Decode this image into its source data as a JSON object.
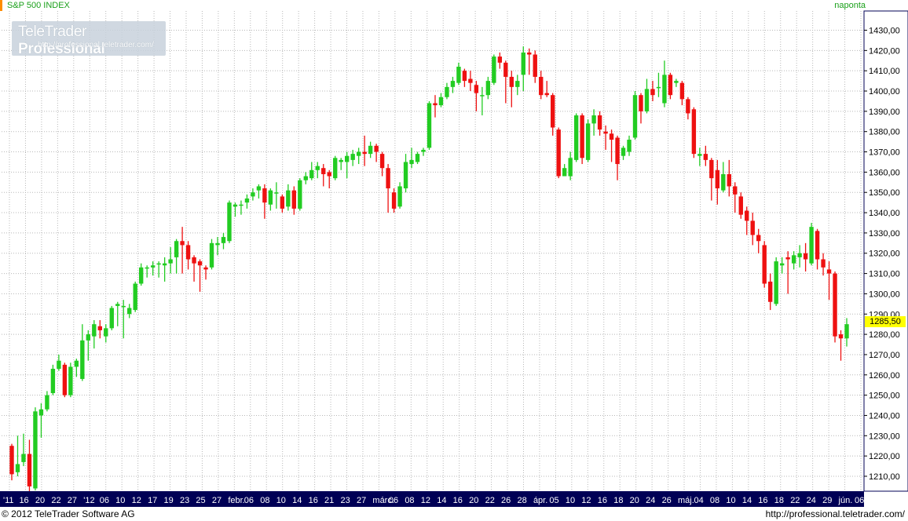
{
  "header": {
    "title": "S&P 500 INDEX",
    "interval": "naponta"
  },
  "logo": {
    "brand": "TeleTrader",
    "product": "Professional",
    "url": "http://professional.teletrader.com/"
  },
  "footer": {
    "copyright": "© 2012 TeleTrader Software AG",
    "url": "http://professional.teletrader.com/"
  },
  "colors": {
    "up": "#22cc22",
    "down": "#ee1111",
    "grid": "#b8b8b8",
    "axis_bg": "#000055",
    "last_value_bg": "#ffff00",
    "title": "#1aa01a"
  },
  "chart_data": {
    "type": "candlestick",
    "title": "S&P 500 INDEX",
    "ylim": [
      1200,
      1440
    ],
    "y_ticks": [
      "1210,00",
      "1220,00",
      "1230,00",
      "1240,00",
      "1250,00",
      "1260,00",
      "1270,00",
      "1280,00",
      "1290,00",
      "1300,00",
      "1310,00",
      "1320,00",
      "1330,00",
      "1340,00",
      "1350,00",
      "1360,00",
      "1370,00",
      "1380,00",
      "1390,00",
      "1400,00",
      "1410,00",
      "1420,00",
      "1430,00"
    ],
    "last_value": "1285,50",
    "grid": true,
    "x_labels": [
      "'11",
      "16",
      "20",
      "22",
      "27",
      "'12",
      "06",
      "10",
      "12",
      "17",
      "19",
      "23",
      "25",
      "27",
      "febr.",
      "06",
      "08",
      "10",
      "14",
      "16",
      "21",
      "23",
      "27",
      "márc.",
      "06",
      "08",
      "12",
      "14",
      "16",
      "20",
      "22",
      "26",
      "28",
      "ápr.",
      "05",
      "10",
      "12",
      "16",
      "18",
      "20",
      "24",
      "26",
      "máj.",
      "04",
      "08",
      "10",
      "14",
      "16",
      "18",
      "22",
      "24",
      "29",
      "jún.",
      "06"
    ],
    "candles": [
      [
        1225,
        1211,
        1208,
        1226
      ],
      [
        1212,
        1216,
        1210,
        1230
      ],
      [
        1217,
        1221,
        1215,
        1231
      ],
      [
        1221,
        1205,
        1202,
        1228
      ],
      [
        1204,
        1242,
        1203,
        1244
      ],
      [
        1240,
        1243,
        1229,
        1246
      ],
      [
        1243,
        1250,
        1242,
        1252
      ],
      [
        1251,
        1263,
        1250,
        1265
      ],
      [
        1263,
        1267,
        1262,
        1270
      ],
      [
        1265,
        1250,
        1249,
        1266
      ],
      [
        1250,
        1264,
        1249,
        1266
      ],
      [
        1264,
        1267,
        1259,
        1268
      ],
      [
        1258,
        1277,
        1257,
        1285
      ],
      [
        1277,
        1280,
        1267,
        1282
      ],
      [
        1279,
        1285,
        1273,
        1287
      ],
      [
        1284,
        1282,
        1278,
        1287
      ],
      [
        1279,
        1283,
        1276,
        1285
      ],
      [
        1283,
        1293,
        1282,
        1294
      ],
      [
        1294,
        1295,
        1284,
        1296
      ],
      [
        1294,
        1294,
        1278,
        1297
      ],
      [
        1290,
        1293,
        1288,
        1295
      ],
      [
        1292,
        1305,
        1291,
        1306
      ],
      [
        1305,
        1313,
        1304,
        1315
      ],
      [
        1313,
        1313,
        1308,
        1314
      ],
      [
        1313,
        1314,
        1309,
        1316
      ],
      [
        1315,
        1315,
        1308,
        1316
      ],
      [
        1314,
        1315,
        1306,
        1318
      ],
      [
        1315,
        1317,
        1310,
        1323
      ],
      [
        1318,
        1326,
        1310,
        1327
      ],
      [
        1326,
        1324,
        1310,
        1333
      ],
      [
        1324,
        1317,
        1312,
        1326
      ],
      [
        1318,
        1315,
        1306,
        1319
      ],
      [
        1316,
        1314,
        1301,
        1317
      ],
      [
        1313,
        1312,
        1307,
        1314
      ],
      [
        1313,
        1325,
        1312,
        1327
      ],
      [
        1324,
        1325,
        1319,
        1328
      ],
      [
        1325,
        1328,
        1322,
        1330
      ],
      [
        1326,
        1345,
        1325,
        1346
      ],
      [
        1343,
        1344,
        1338,
        1345
      ],
      [
        1344,
        1344,
        1339,
        1346
      ],
      [
        1345,
        1347,
        1342,
        1349
      ],
      [
        1348,
        1350,
        1346,
        1352
      ],
      [
        1351,
        1353,
        1347,
        1354
      ],
      [
        1352,
        1345,
        1337,
        1354
      ],
      [
        1344,
        1351,
        1341,
        1352
      ],
      [
        1350,
        1350,
        1342,
        1355
      ],
      [
        1348,
        1342,
        1340,
        1349
      ],
      [
        1343,
        1351,
        1341,
        1354
      ],
      [
        1351,
        1342,
        1339,
        1353
      ],
      [
        1342,
        1356,
        1341,
        1357
      ],
      [
        1356,
        1358,
        1354,
        1360
      ],
      [
        1357,
        1361,
        1356,
        1365
      ],
      [
        1361,
        1363,
        1357,
        1365
      ],
      [
        1362,
        1359,
        1353,
        1364
      ],
      [
        1360,
        1358,
        1352,
        1361
      ],
      [
        1357,
        1367,
        1356,
        1368
      ],
      [
        1365,
        1366,
        1361,
        1367
      ],
      [
        1365,
        1368,
        1357,
        1370
      ],
      [
        1366,
        1369,
        1363,
        1371
      ],
      [
        1368,
        1370,
        1364,
        1372
      ],
      [
        1370,
        1369,
        1363,
        1378
      ],
      [
        1369,
        1373,
        1367,
        1375
      ],
      [
        1373,
        1370,
        1365,
        1374
      ],
      [
        1369,
        1362,
        1358,
        1370
      ],
      [
        1362,
        1352,
        1340,
        1364
      ],
      [
        1350,
        1342,
        1340,
        1352
      ],
      [
        1343,
        1353,
        1342,
        1355
      ],
      [
        1352,
        1365,
        1350,
        1369
      ],
      [
        1364,
        1366,
        1362,
        1372
      ],
      [
        1365,
        1369,
        1364,
        1370
      ],
      [
        1370,
        1371,
        1368,
        1372
      ],
      [
        1372,
        1394,
        1371,
        1395
      ],
      [
        1394,
        1393,
        1387,
        1398
      ],
      [
        1393,
        1397,
        1392,
        1399
      ],
      [
        1397,
        1402,
        1396,
        1404
      ],
      [
        1402,
        1405,
        1399,
        1407
      ],
      [
        1404,
        1412,
        1403,
        1414
      ],
      [
        1410,
        1405,
        1402,
        1411
      ],
      [
        1406,
        1404,
        1400,
        1410
      ],
      [
        1403,
        1399,
        1390,
        1405
      ],
      [
        1398,
        1398,
        1388,
        1402
      ],
      [
        1398,
        1405,
        1396,
        1407
      ],
      [
        1404,
        1417,
        1403,
        1418
      ],
      [
        1417,
        1414,
        1411,
        1419
      ],
      [
        1414,
        1407,
        1394,
        1415
      ],
      [
        1407,
        1402,
        1392,
        1410
      ],
      [
        1402,
        1405,
        1398,
        1408
      ],
      [
        1408,
        1419,
        1400,
        1422
      ],
      [
        1419,
        1418,
        1408,
        1421
      ],
      [
        1418,
        1407,
        1404,
        1420
      ],
      [
        1407,
        1398,
        1396,
        1410
      ],
      [
        1399,
        1398,
        1397,
        1405
      ],
      [
        1398,
        1382,
        1378,
        1399
      ],
      [
        1381,
        1358,
        1357,
        1382
      ],
      [
        1358,
        1362,
        1360,
        1364
      ],
      [
        1358,
        1367,
        1356,
        1370
      ],
      [
        1366,
        1388,
        1365,
        1389
      ],
      [
        1388,
        1367,
        1364,
        1389
      ],
      [
        1366,
        1384,
        1365,
        1386
      ],
      [
        1384,
        1388,
        1378,
        1391
      ],
      [
        1388,
        1381,
        1378,
        1390
      ],
      [
        1380,
        1379,
        1371,
        1383
      ],
      [
        1379,
        1376,
        1365,
        1381
      ],
      [
        1377,
        1364,
        1356,
        1378
      ],
      [
        1368,
        1372,
        1366,
        1373
      ],
      [
        1370,
        1376,
        1368,
        1378
      ],
      [
        1377,
        1398,
        1376,
        1400
      ],
      [
        1398,
        1390,
        1384,
        1399
      ],
      [
        1390,
        1401,
        1389,
        1406
      ],
      [
        1401,
        1398,
        1395,
        1405
      ],
      [
        1402,
        1402,
        1397,
        1409
      ],
      [
        1394,
        1408,
        1392,
        1415
      ],
      [
        1408,
        1398,
        1396,
        1409
      ],
      [
        1404,
        1405,
        1402,
        1406
      ],
      [
        1404,
        1396,
        1393,
        1405
      ],
      [
        1396,
        1389,
        1386,
        1397
      ],
      [
        1391,
        1369,
        1367,
        1392
      ],
      [
        1368,
        1369,
        1363,
        1372
      ],
      [
        1369,
        1366,
        1363,
        1373
      ],
      [
        1366,
        1357,
        1346,
        1367
      ],
      [
        1361,
        1352,
        1344,
        1366
      ],
      [
        1351,
        1359,
        1350,
        1365
      ],
      [
        1359,
        1353,
        1348,
        1366
      ],
      [
        1353,
        1349,
        1340,
        1355
      ],
      [
        1348,
        1339,
        1337,
        1350
      ],
      [
        1341,
        1336,
        1329,
        1343
      ],
      [
        1336,
        1329,
        1324,
        1340
      ],
      [
        1329,
        1326,
        1320,
        1332
      ],
      [
        1324,
        1305,
        1303,
        1326
      ],
      [
        1306,
        1296,
        1292,
        1310
      ],
      [
        1295,
        1316,
        1294,
        1318
      ],
      [
        1314,
        1315,
        1310,
        1318
      ],
      [
        1318,
        1317,
        1300,
        1321
      ],
      [
        1315,
        1319,
        1312,
        1321
      ],
      [
        1318,
        1320,
        1313,
        1324
      ],
      [
        1320,
        1317,
        1311,
        1325
      ],
      [
        1315,
        1333,
        1314,
        1335
      ],
      [
        1331,
        1317,
        1312,
        1332
      ],
      [
        1317,
        1313,
        1309,
        1320
      ],
      [
        1312,
        1310,
        1297,
        1316
      ],
      [
        1310,
        1279,
        1276,
        1311
      ],
      [
        1280,
        1278,
        1267,
        1282
      ],
      [
        1278,
        1285,
        1274,
        1288
      ]
    ]
  }
}
